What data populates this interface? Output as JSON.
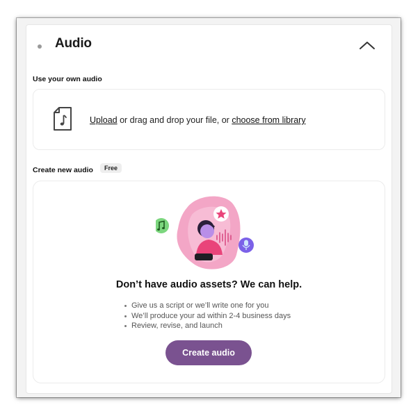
{
  "section": {
    "title": "Audio",
    "collapse_icon": "chevron-up-icon"
  },
  "own_audio": {
    "label": "Use your own audio",
    "file_icon": "music-file-icon",
    "upload_link": "Upload",
    "middle_text": " or drag and drop your file, or ",
    "library_link": "choose from library"
  },
  "new_audio": {
    "label": "Create new audio",
    "badge": "Free",
    "headline": "Don’t have audio assets? We can help.",
    "bullets": [
      "Give us a script or we’ll write one for you",
      "We’ll produce your ad within 2-4 business days",
      "Review, revise, and launch"
    ],
    "button_label": "Create audio"
  },
  "colors": {
    "button": "#7a5290",
    "illustration_pink": "#f3a6c6",
    "note_green": "#7cd67e",
    "mic_purple": "#7b61e8"
  }
}
